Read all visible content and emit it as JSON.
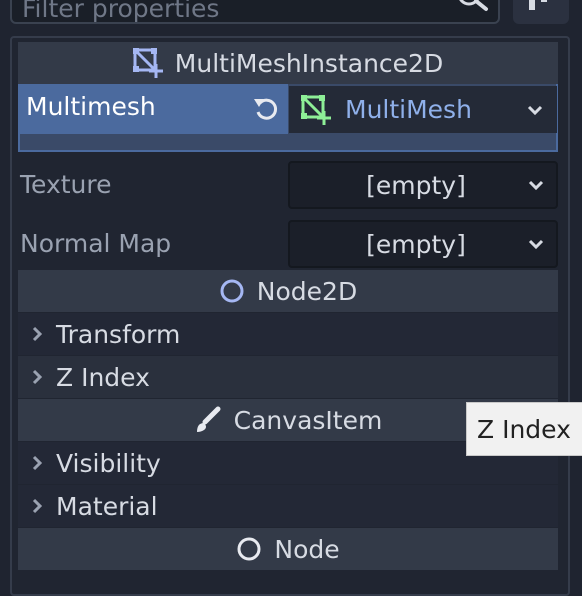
{
  "filter": {
    "placeholder": "Filter properties"
  },
  "sections": {
    "multimesh_instance": {
      "title": "MultiMeshInstance2D"
    },
    "node2d": {
      "title": "Node2D"
    },
    "canvas_item": {
      "title": "CanvasItem"
    },
    "node": {
      "title": "Node"
    }
  },
  "properties": {
    "multimesh": {
      "label": "Multimesh",
      "value": "MultiMesh"
    },
    "texture": {
      "label": "Texture",
      "value": "[empty]"
    },
    "normal_map": {
      "label": "Normal Map",
      "value": "[empty]"
    }
  },
  "groups": {
    "transform": "Transform",
    "z_index": "Z Index",
    "visibility": "Visibility",
    "material": "Material"
  },
  "tooltip": {
    "text": "Z Index"
  },
  "icons": {
    "search": "search-icon",
    "multimesh_instance": "multimesh-instance-icon",
    "reset": "reset-icon",
    "multimesh": "multimesh-icon",
    "node2d": "node2d-circle-icon",
    "canvas_item": "brush-icon",
    "node": "node-circle-icon"
  },
  "colors": {
    "accent_blue": "#4b6a9e",
    "resource_blue": "#8fb0ea",
    "node2d_blue": "#a5b7f3",
    "mesh_green": "#8eef97"
  }
}
